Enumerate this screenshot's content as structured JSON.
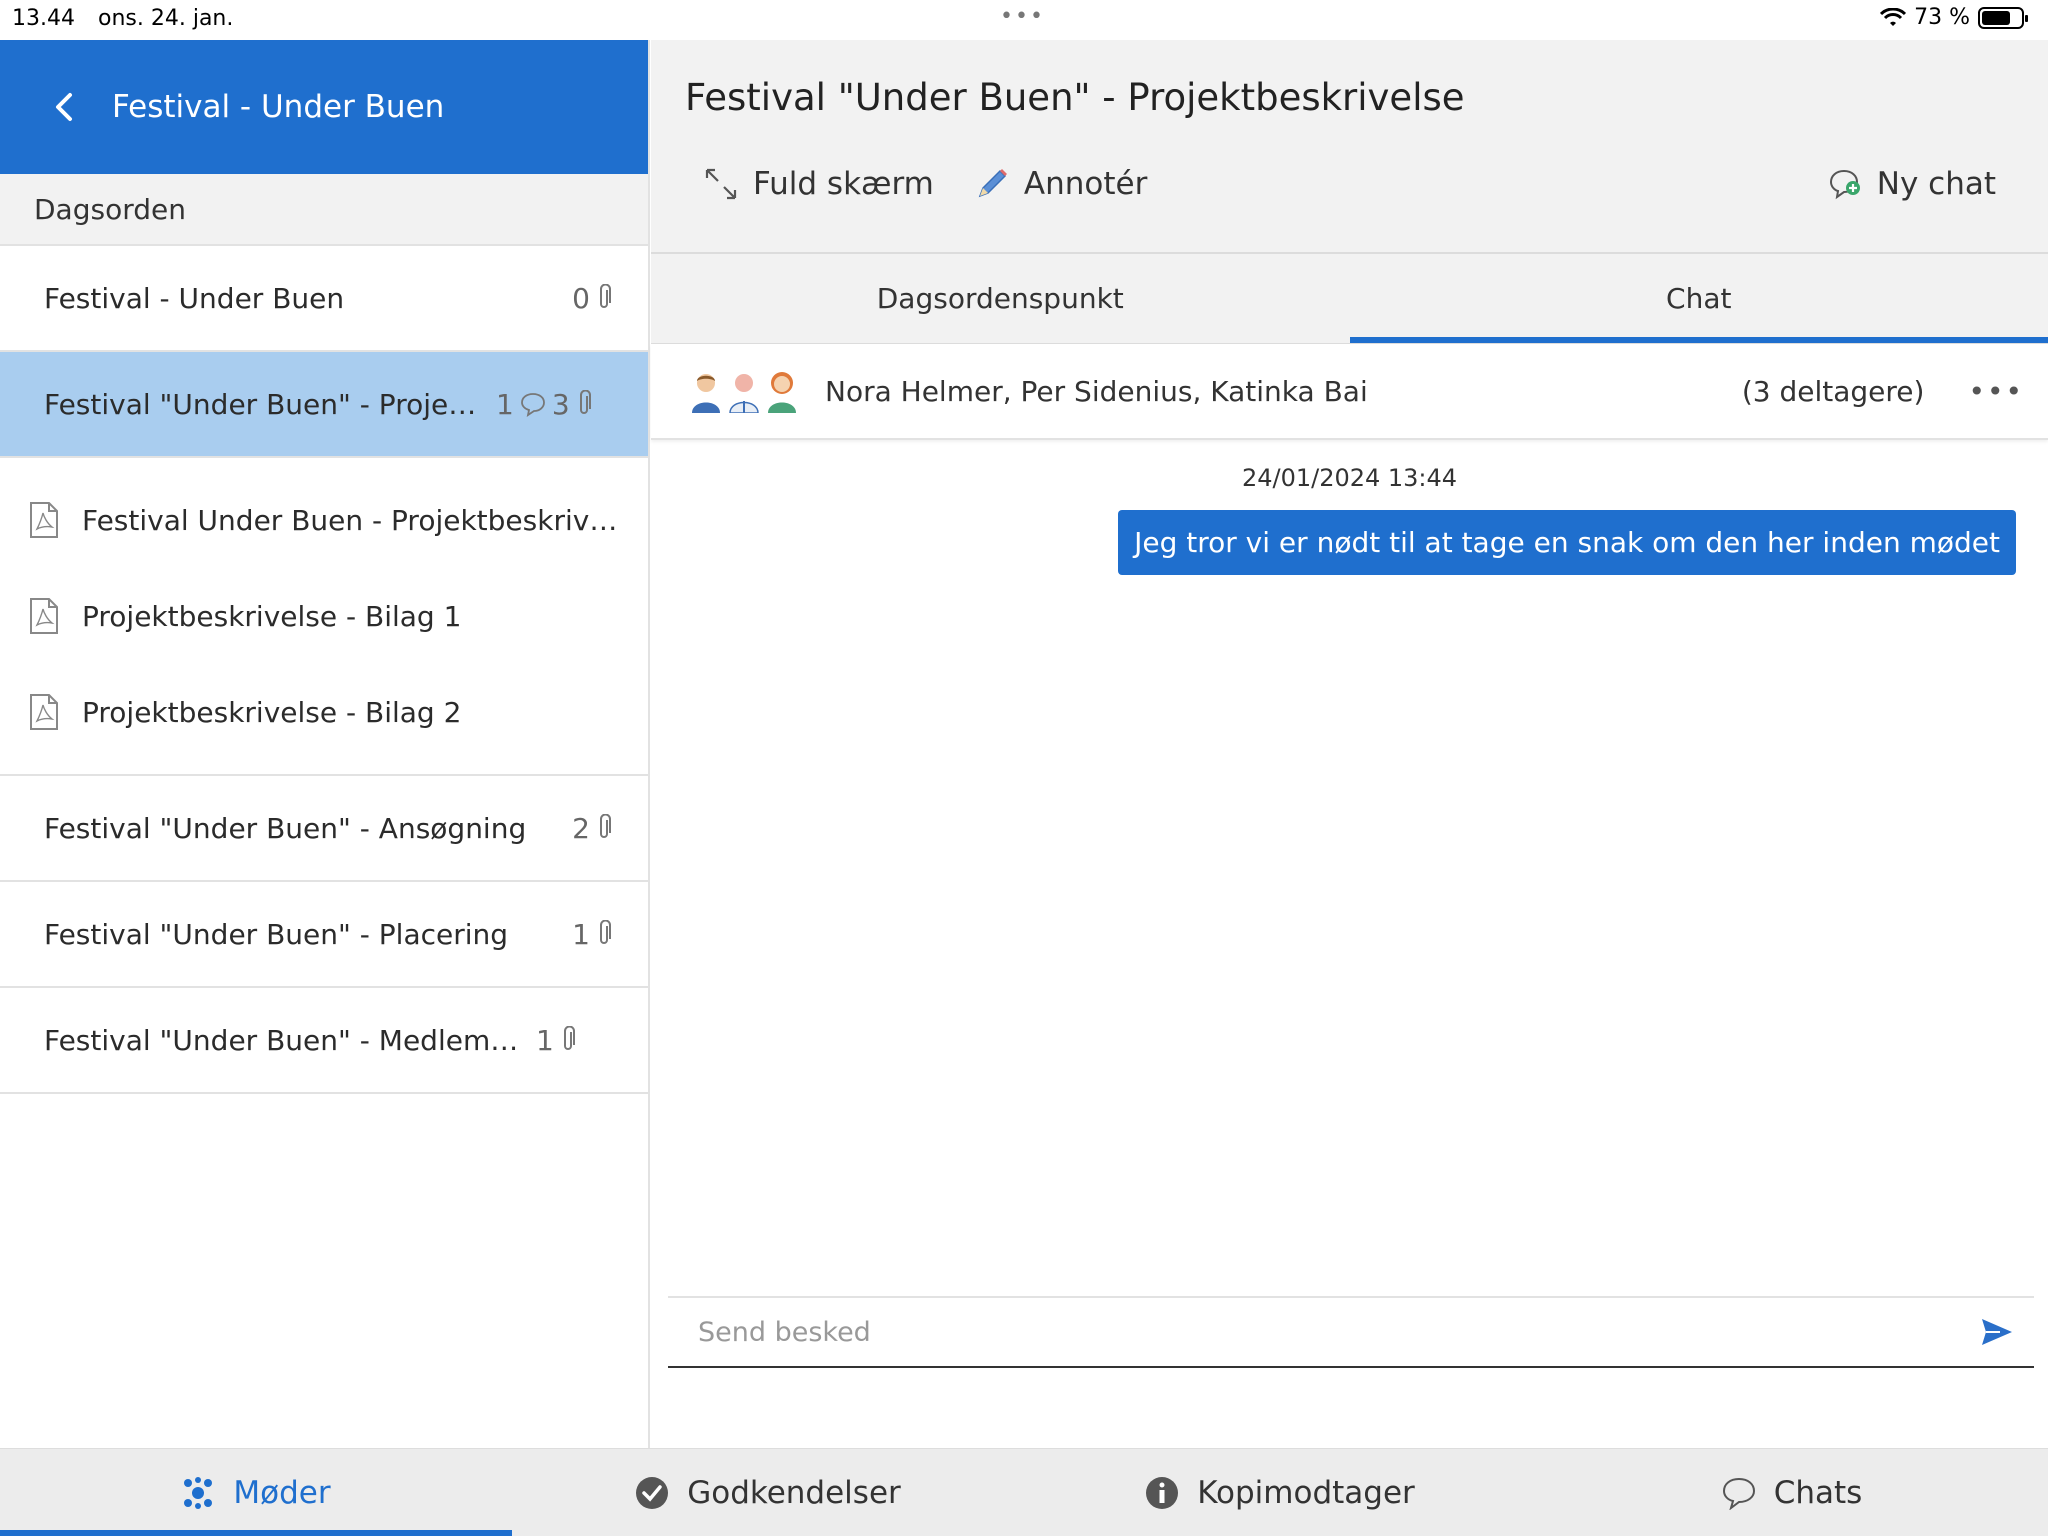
{
  "status_bar": {
    "time": "13.44",
    "date": "ons. 24. jan.",
    "dots": "•••",
    "battery": "73 %",
    "battery_level": 0.73
  },
  "sidebar": {
    "title": "Festival - Under Buen",
    "section": "Dagsorden",
    "items": [
      {
        "label": "Festival - Under Buen",
        "attachments": "0"
      },
      {
        "label": "Festival \"Under Buen\" - Projektbeskrivelse",
        "chats": "1",
        "attachments": "3",
        "selected": true
      },
      {
        "label": "Festival \"Under Buen\" - Ansøgning",
        "attachments": "2"
      },
      {
        "label": "Festival \"Under Buen\" - Placering",
        "attachments": "1"
      },
      {
        "label": "Festival \"Under Buen\" - Medlemsliste",
        "attachments": "1"
      }
    ],
    "attachments": [
      {
        "label": "Festival Under Buen - Projektbeskrivelse"
      },
      {
        "label": "Projektbeskrivelse - Bilag 1"
      },
      {
        "label": "Projektbeskrivelse - Bilag 2"
      }
    ]
  },
  "document": {
    "title": "Festival \"Under Buen\" - Projektbeskrivelse",
    "toolbar": {
      "fullscreen": "Fuld skærm",
      "annotate": "Annotér",
      "new_chat": "Ny chat"
    },
    "tabs": [
      {
        "label": "Dagsordenspunkt"
      },
      {
        "label": "Chat",
        "active": true
      }
    ]
  },
  "chat": {
    "participants": "Nora Helmer, Per Sidenius, Katinka Bai",
    "participants_count": "(3 deltagere)",
    "timestamp": "24/01/2024 13:44",
    "messages": [
      {
        "text": "Jeg tror vi er nødt til at tage en snak om den her inden mødet",
        "own": true
      }
    ],
    "input_placeholder": "Send besked"
  },
  "tabbar": {
    "items": [
      {
        "label": "Møder",
        "icon": "meetings-icon",
        "active": true
      },
      {
        "label": "Godkendelser",
        "icon": "check-circle-icon"
      },
      {
        "label": "Kopimodtager",
        "icon": "info-icon"
      },
      {
        "label": "Chats",
        "icon": "chat-bubble-icon"
      }
    ]
  },
  "colors": {
    "accent": "#1f6fce",
    "selected_row": "#a9cdef",
    "header_bg": "#f2f2f2"
  }
}
